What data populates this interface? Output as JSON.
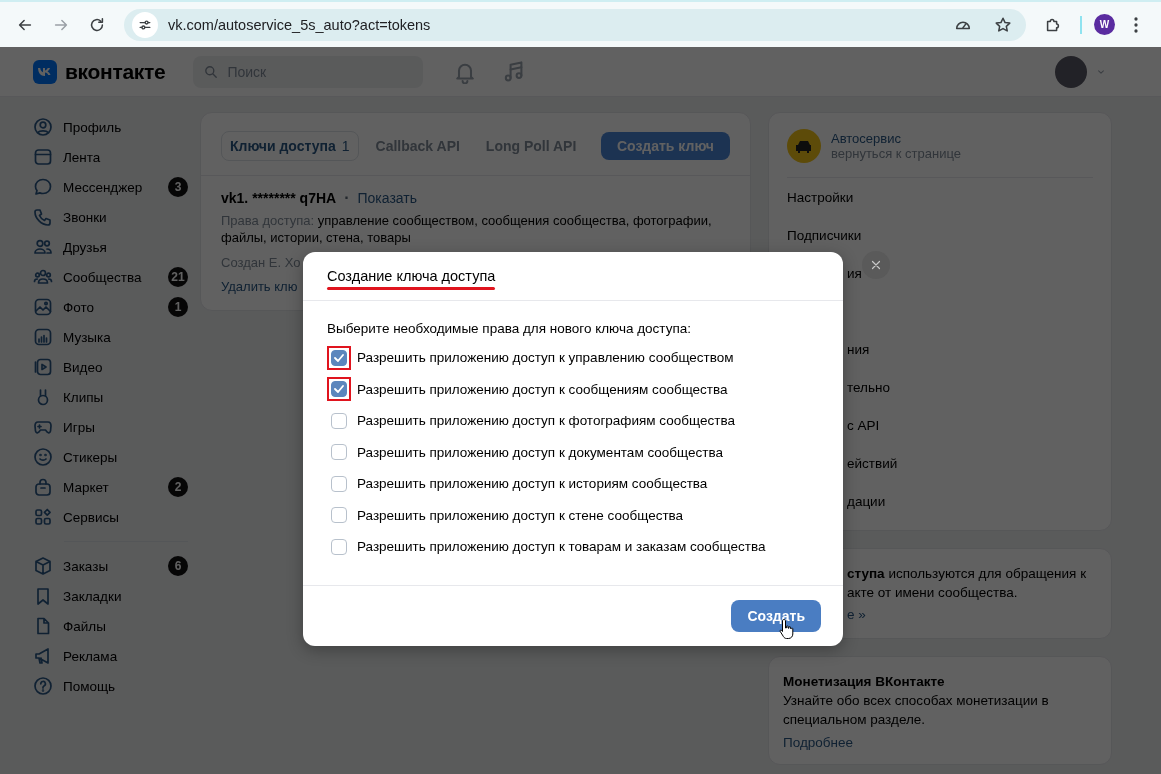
{
  "browser": {
    "url": "vk.com/autoservice_5s_auto?act=tokens",
    "profile_initial": "W"
  },
  "header": {
    "logo_text": "вконтакте",
    "search": {
      "placeholder": "Поиск"
    }
  },
  "sidebar": {
    "main": [
      {
        "label": "Профиль"
      },
      {
        "label": "Лента"
      },
      {
        "label": "Мессенджер",
        "badge": "3"
      },
      {
        "label": "Звонки"
      },
      {
        "label": "Друзья"
      },
      {
        "label": "Сообщества",
        "badge": "21"
      },
      {
        "label": "Фото",
        "badge": "1"
      },
      {
        "label": "Музыка"
      },
      {
        "label": "Видео"
      },
      {
        "label": "Клипы"
      },
      {
        "label": "Игры"
      },
      {
        "label": "Стикеры"
      },
      {
        "label": "Маркет",
        "badge": "2"
      },
      {
        "label": "Сервисы"
      }
    ],
    "secondary": [
      {
        "label": "Заказы",
        "badge": "6"
      },
      {
        "label": "Закладки"
      },
      {
        "label": "Файлы"
      },
      {
        "label": "Реклама"
      },
      {
        "label": "Помощь"
      }
    ]
  },
  "tokens_card": {
    "tabs": [
      {
        "label": "Ключи доступа",
        "count": "1",
        "selected": true
      },
      {
        "label": "Callback API",
        "selected": false
      },
      {
        "label": "Long Poll API",
        "selected": false
      }
    ],
    "create_button": "Создать ключ",
    "key": {
      "value": "vk1. ******** q7HA",
      "separator": "·",
      "show_link": "Показать",
      "rights_label": "Права доступа:",
      "rights": "управление сообществом, сообщения сообщества, фотографии, файлы, истории, стена, товары",
      "created": "Создан Е. Хо",
      "delete_link": "Удалить клю"
    }
  },
  "community_card": {
    "name": "Автосервис",
    "back_link": "вернуться к странице",
    "menu": [
      {
        "label": "Настройки"
      },
      {
        "label": "Подписчики"
      },
      {
        "label": "ия"
      },
      {
        "label": "ния"
      },
      {
        "label": "тельно"
      },
      {
        "label": "с API"
      },
      {
        "label": "ействий"
      },
      {
        "label": "дации"
      }
    ]
  },
  "info_card": {
    "lines": [
      "**ступа** используются для обращения к",
      "акте от имени сообщества."
    ],
    "link": "е »"
  },
  "monetization_card": {
    "title": "Монетизация ВКонтакте",
    "text": "Узнайте обо всех способах монетизации в специальном разделе.",
    "link": "Подробнее"
  },
  "modal": {
    "title": "Создание ключа доступа",
    "prompt": "Выберите необходимые права для нового ключа доступа:",
    "permissions": [
      {
        "label": "Разрешить приложению доступ к управлению сообществом",
        "checked": true
      },
      {
        "label": "Разрешить приложению доступ к сообщениям сообщества",
        "checked": true
      },
      {
        "label": "Разрешить приложению доступ к фотографиям сообщества",
        "checked": false
      },
      {
        "label": "Разрешить приложению доступ к документам сообщества",
        "checked": false
      },
      {
        "label": "Разрешить приложению доступ к историям сообщества",
        "checked": false
      },
      {
        "label": "Разрешить приложению доступ к стене сообщества",
        "checked": false
      },
      {
        "label": "Разрешить приложению доступ к товарам и заказам сообщества",
        "checked": false
      }
    ],
    "submit_button": "Создать"
  }
}
